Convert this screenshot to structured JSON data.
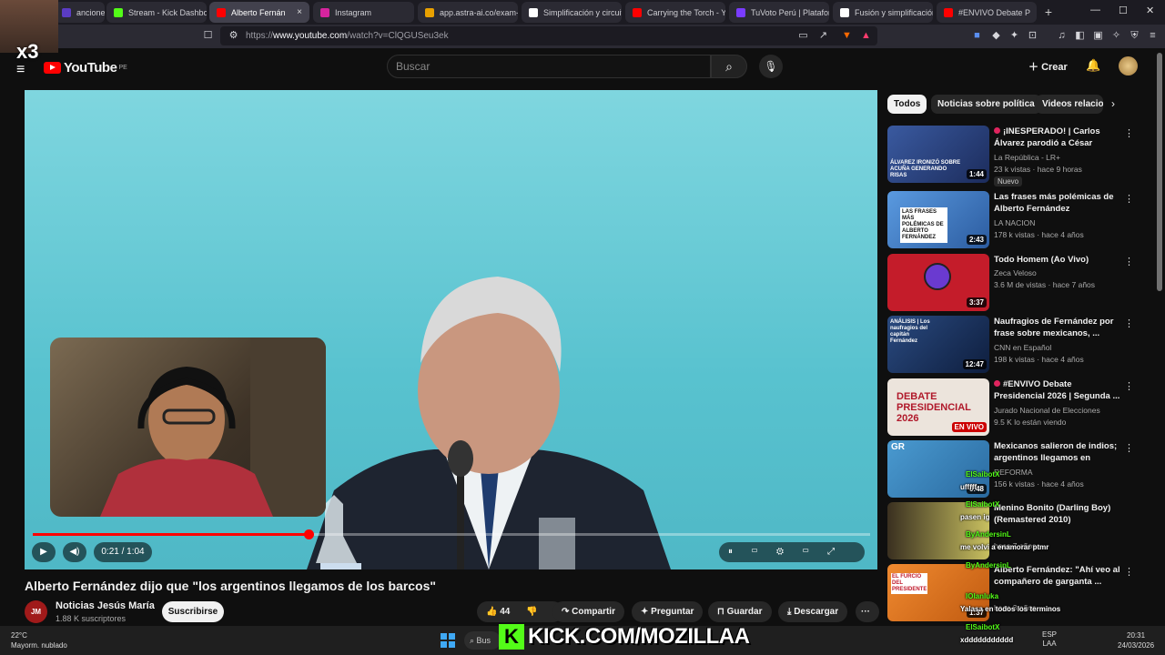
{
  "browser": {
    "tabs": [
      {
        "label": "anciones qu",
        "color": "#5b3cc4"
      },
      {
        "label": "Stream - Kick Dashboa",
        "color": "#53fc18"
      },
      {
        "label": "Alberto Fernán",
        "color": "#ff0000",
        "close": "×"
      },
      {
        "label": "Instagram",
        "color": "#d6249f"
      },
      {
        "label": "app.astra-ai.co/exam-p",
        "color": "#e8a000"
      },
      {
        "label": "Simplificación y circuit",
        "color": "#ffffff"
      },
      {
        "label": "Carrying the Torch - Yo",
        "color": "#ff0000"
      },
      {
        "label": "TuVoto Perú | Plataform",
        "color": "#7a3cff"
      },
      {
        "label": "Fusión y simplificación",
        "color": "#ffffff"
      },
      {
        "label": "#ENVIVO Debate P",
        "color": "#ff0000"
      }
    ],
    "new_tab": "+",
    "url_prefix": "https://",
    "url_host": "www.youtube.com",
    "url_path": "/watch?v=ClQGUSeu3ek",
    "window_controls": [
      "—",
      "☐",
      "✕"
    ]
  },
  "stream_overlay": {
    "multiplier": "x3",
    "kick_letter": "K",
    "kick_url": "KICK.COM/MOZILLAA"
  },
  "youtube": {
    "logo_text": "YouTube",
    "region": "PE",
    "search_placeholder": "Buscar",
    "create_label": "Crear",
    "chips": [
      "Todos",
      "Noticias sobre política",
      "Videos relacion"
    ],
    "video": {
      "time": "0:21 / 1:04",
      "progress_fraction": 0.33,
      "title": "Alberto Fernández dijo que \"los argentinos llegamos de los barcos\"",
      "channel_logo": "JM",
      "channel": "Noticias Jesús María",
      "subscribers": "1.88 K suscriptores",
      "subscribe_label": "Suscribirse",
      "likes": "44",
      "share_label": "Compartir",
      "ask_label": "Preguntar",
      "save_label": "Guardar",
      "download_label": "Descargar",
      "more": "···"
    },
    "recommendations": [
      {
        "title": "¡INESPERADO! | Carlos Álvarez parodió a César Acuña...",
        "channel": "La República - LR+",
        "meta": "23 k vistas · hace 9 horas",
        "duration": "1:44",
        "badge": "Nuevo",
        "live_dot": true,
        "thumb": "#2c4a8c"
      },
      {
        "title": "Las frases más polémicas de Alberto Fernández",
        "channel": "LA NACION",
        "meta": "178 k vistas · hace 4 años",
        "duration": "2:43",
        "thumb": "#4a8ad0"
      },
      {
        "title": "Todo Homem (Ao Vivo)",
        "channel": "Zeca Veloso",
        "meta": "3.6 M de vistas · hace 7 años",
        "duration": "3:37",
        "thumb": "#c41c2a"
      },
      {
        "title": "Naufragios de Fernández por frase sobre mexicanos, ...",
        "channel": "CNN en Español",
        "meta": "198 k vistas · hace 4 años",
        "duration": "12:47",
        "thumb": "#1c3c6c"
      },
      {
        "title": "#ENVIVO Debate Presidencial 2026 | Segunda ...",
        "channel": "Jurado Nacional de Elecciones",
        "meta": "9.5 K lo están viendo",
        "duration": "EN VIVO",
        "live": true,
        "live_dot": true,
        "thumb": "#e8e0d8"
      },
      {
        "title": "Mexicanos salieron de indios; argentinos llegamos en barco...",
        "channel": "REFORMA",
        "meta": "156 k vistas · hace 4 años",
        "duration": "0:48",
        "thumb": "#3a8ac0"
      },
      {
        "title": "Menino Bonito (Darling Boy) (Remastered 2010)",
        "channel": "",
        "meta": "hace 7 años",
        "duration": "",
        "thumb": "#c8c060"
      },
      {
        "title": "Alberto Fernández: \"Ahí veo al compañero de garganta ...",
        "channel": "",
        "meta": "hace 3 años",
        "duration": "1:37",
        "thumb": "#e87a2a"
      }
    ],
    "thumb_captions": [
      "ÁLVAREZ IRONIZÓ SOBRE ACUÑA GENERANDO RISAS",
      "LAS FRASES MÁS POLÉMICAS DE ALBERTO FERNÁNDEZ",
      "ANÁLISIS | Los naufragios del capitán Fernández",
      "DEBATE PRESIDENCIAL 2026",
      "GR",
      "EL FURCIO DEL PRESIDENTE"
    ]
  },
  "chat": [
    {
      "user": "ElSaibotX",
      "msg": "ufffff"
    },
    {
      "user": "ElSaibotX",
      "msg": "pasen ig"
    },
    {
      "user": "ByAndersinL",
      "msg": "me volvi a enamorar ptmr"
    },
    {
      "user": "ByAndersinL",
      "msg": ""
    },
    {
      "user": "IOlanluka",
      "msg": "Yalasa en todos los terminos"
    },
    {
      "user": "ElSaibotX",
      "msg": "xddddddddddd"
    }
  ],
  "taskbar": {
    "temp": "22°C",
    "weather": "Mayorm. nublado",
    "search": "Bus",
    "lang1": "ESP",
    "lang2": "LAA",
    "time": "20:31",
    "date": "24/03/2026"
  }
}
